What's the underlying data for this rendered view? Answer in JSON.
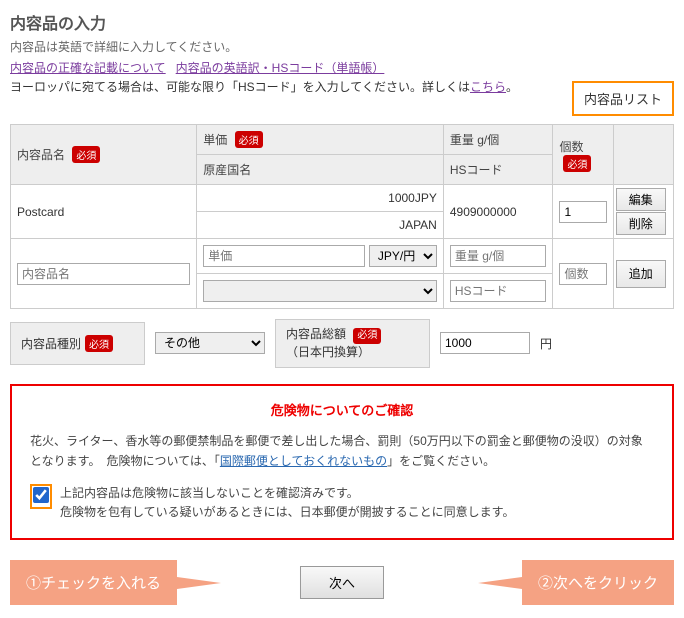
{
  "page": {
    "title": "内容品の入力",
    "subtitle": "内容品は英語で詳細に入力してください。",
    "link1": "内容品の正確な記載について",
    "link2": "内容品の英語訳・HSコード（単語帳）",
    "europe_note_a": "ヨーロッパに宛てる場合は、可能な限り「HSコード」を入力してください。詳しくは",
    "europe_link": "こちら",
    "europe_note_b": "。",
    "list_button": "内容品リスト",
    "required": "必須"
  },
  "table": {
    "h_name": "内容品名",
    "h_price": "単価",
    "h_origin": "原産国名",
    "h_weight": "重量 g/個",
    "h_hscode": "HSコード",
    "h_qty": "個数",
    "row": {
      "name": "Postcard",
      "price": "1000JPY",
      "origin": "JAPAN",
      "hscode": "4909000000",
      "qty": "1"
    },
    "btn_edit": "編集",
    "btn_delete": "削除",
    "btn_add": "追加",
    "input": {
      "name_ph": "内容品名",
      "price_ph": "単価",
      "currency_sel": "JPY/円",
      "weight_ph": "重量 g/個",
      "hscode_ph": "HSコード",
      "qty_ph": "個数"
    }
  },
  "summary": {
    "kind_label": "内容品種別",
    "kind_sel": "その他",
    "total_label1": "内容品総額",
    "total_label2": "（日本円換算）",
    "total_val": "1000",
    "unit": "円"
  },
  "hazmat": {
    "title": "危険物についてのご確認",
    "body1": "花火、ライター、香水等の郵便禁制品を郵便で差し出した場合、罰則（50万円以下の罰金と郵便物の没収）の対象となります。　危険物については、「",
    "body_link": "国際郵便としておくれないもの",
    "body2": "」をご覧ください。",
    "check1": "上記内容品は危険物に該当しないことを確認済みです。",
    "check2": "危険物を包有している疑いがあるときには、日本郵便が開披することに同意します。"
  },
  "callouts": {
    "c1": "①チェックを入れる",
    "next": "次へ",
    "c2": "②次へをクリック"
  }
}
